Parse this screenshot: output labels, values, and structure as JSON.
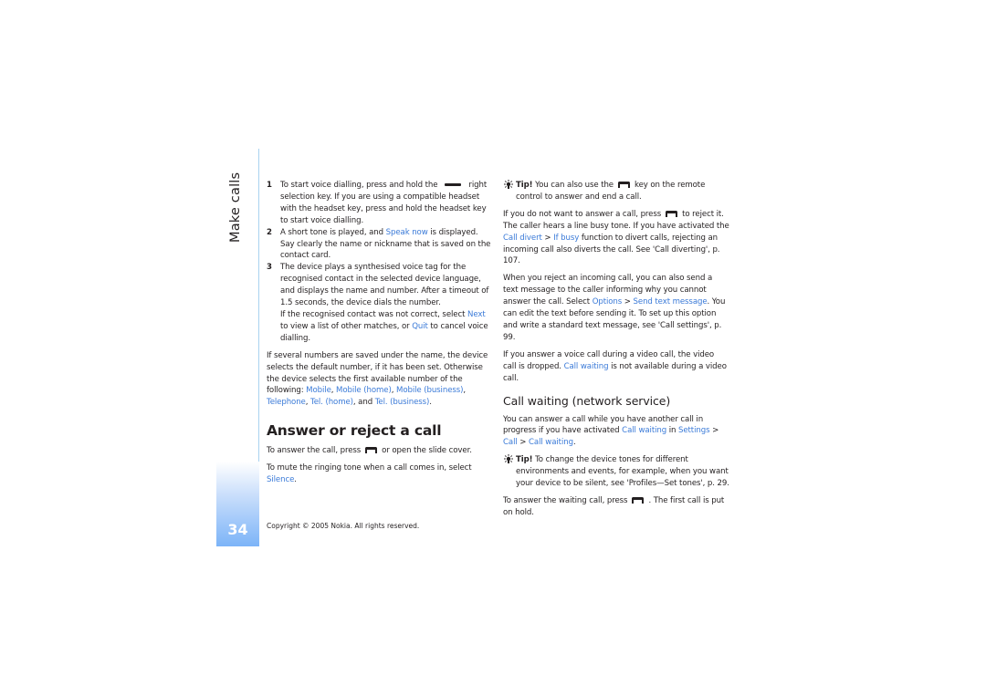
{
  "section": {
    "title": "Make calls",
    "page_number": "34"
  },
  "col1": {
    "steps": [
      {
        "num": "1",
        "parts": [
          [
            "t",
            "To start voice dialling, press and hold the"
          ],
          [
            "dash",
            ""
          ],
          [
            "t",
            "right selection key. If you are using a compatible headset with the headset key, press and hold the headset key to start voice dialling."
          ]
        ]
      },
      {
        "num": "2",
        "parts": [
          [
            "t",
            "A short tone is played, and "
          ],
          [
            "l",
            "Speak now"
          ],
          [
            "t",
            " is displayed. Say clearly the name or nickname that is saved on the contact card."
          ]
        ]
      },
      {
        "num": "3",
        "parts": [
          [
            "t",
            "The device plays a synthesised voice tag for the recognised contact in the selected device language, and displays the name and number. After a timeout of 1.5 seconds, the device dials the number."
          ],
          [
            "br",
            ""
          ],
          [
            "t",
            "If the recognised contact was not correct, select "
          ],
          [
            "l",
            "Next"
          ],
          [
            "t",
            " to view a list of other matches, or "
          ],
          [
            "l",
            "Quit"
          ],
          [
            "t",
            " to cancel voice dialling."
          ]
        ]
      }
    ],
    "para_numbers": [
      [
        "t",
        "If several numbers are saved under the name, the device selects the default number, if it has been set. Otherwise the device selects the first available number of the following: "
      ],
      [
        "l",
        "Mobile"
      ],
      [
        "t",
        ", "
      ],
      [
        "l",
        "Mobile (home)"
      ],
      [
        "t",
        ", "
      ],
      [
        "l",
        "Mobile (business)"
      ],
      [
        "t",
        ", "
      ],
      [
        "l",
        "Telephone"
      ],
      [
        "t",
        ", "
      ],
      [
        "l",
        "Tel. (home)"
      ],
      [
        "t",
        ", and "
      ],
      [
        "l",
        "Tel. (business)"
      ],
      [
        "t",
        "."
      ]
    ],
    "heading": "Answer or reject a call",
    "para_answer": [
      [
        "t",
        "To answer the call, press"
      ],
      [
        "key",
        ""
      ],
      [
        "t",
        "or open the slide cover."
      ]
    ],
    "para_mute": [
      [
        "t",
        "To mute the ringing tone when a call comes in, select "
      ],
      [
        "l",
        "Silence"
      ],
      [
        "t",
        "."
      ]
    ]
  },
  "col2": {
    "tip1": [
      [
        "b",
        "Tip!"
      ],
      [
        "t",
        " You can also use the"
      ],
      [
        "key",
        ""
      ],
      [
        "t",
        "key on the remote control to answer and end a call."
      ]
    ],
    "para_reject": [
      [
        "t",
        "If you do not want to answer a call, press"
      ],
      [
        "key",
        ""
      ],
      [
        "t",
        "to reject it. The caller hears a line busy tone. If you have activated the "
      ],
      [
        "l",
        "Call divert"
      ],
      [
        "t",
        " > "
      ],
      [
        "l",
        "If busy"
      ],
      [
        "t",
        " function to divert calls, rejecting an incoming call also diverts the call. See 'Call diverting', p. 107."
      ]
    ],
    "para_text": [
      [
        "t",
        "When you reject an incoming call, you can also send a text message to the caller informing why you cannot answer the call. Select "
      ],
      [
        "l",
        "Options"
      ],
      [
        "t",
        " > "
      ],
      [
        "l",
        "Send text message"
      ],
      [
        "t",
        ". You can edit the text before sending it. To set up this option and write a standard text message, see 'Call settings', p. 99."
      ]
    ],
    "para_video": [
      [
        "t",
        "If you answer a voice call during a video call, the video call is dropped. "
      ],
      [
        "l",
        "Call waiting"
      ],
      [
        "t",
        " is not available during a video call."
      ]
    ],
    "heading": "Call waiting (network service)",
    "para_waiting": [
      [
        "t",
        "You can answer a call while you have another call in progress if you have activated "
      ],
      [
        "l",
        "Call waiting"
      ],
      [
        "t",
        " in "
      ],
      [
        "l",
        "Settings"
      ],
      [
        "t",
        " > "
      ],
      [
        "l",
        "Call"
      ],
      [
        "t",
        " > "
      ],
      [
        "l",
        "Call waiting"
      ],
      [
        "t",
        "."
      ]
    ],
    "tip2": [
      [
        "b",
        "Tip!"
      ],
      [
        "t",
        " To change the device tones for different environments and events, for example, when you want your device to be silent, see 'Profiles—Set tones', p. 29."
      ]
    ],
    "para_hold": [
      [
        "t",
        "To answer the waiting call, press"
      ],
      [
        "key",
        ""
      ],
      [
        "t",
        ". The first call is put on hold."
      ]
    ]
  },
  "footer": {
    "copyright": "Copyright © 2005 Nokia. All rights reserved."
  },
  "colors": {
    "link": "#3a7ad8",
    "sidebar_gradient_end": "#7cb4f8",
    "rule": "#a9d2f0"
  }
}
